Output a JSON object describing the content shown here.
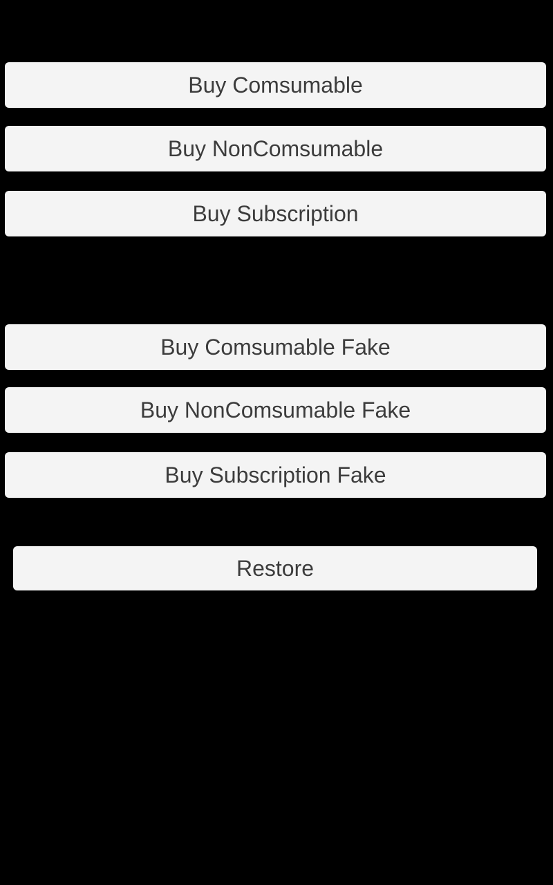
{
  "buttons": {
    "buy_consumable": "Buy Comsumable",
    "buy_nonconsumable": "Buy NonComsumable",
    "buy_subscription": "Buy Subscription",
    "buy_consumable_fake": "Buy Comsumable Fake",
    "buy_nonconsumable_fake": "Buy NonComsumable Fake",
    "buy_subscription_fake": "Buy Subscription Fake",
    "restore": "Restore"
  },
  "colors": {
    "background": "#000000",
    "button_background": "#f4f4f4",
    "button_text": "#3c3c3c"
  }
}
